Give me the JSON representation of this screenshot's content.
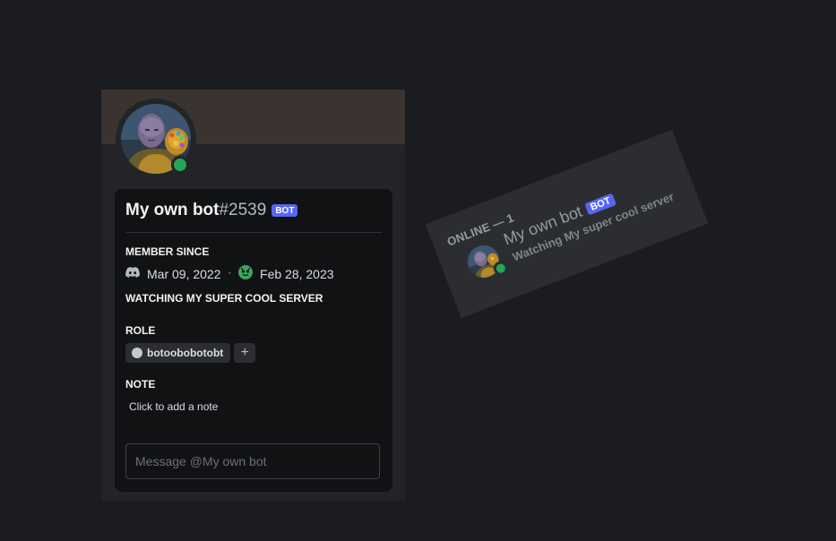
{
  "profile": {
    "username": "My own bot",
    "discriminator": "#2539",
    "bot_tag": "BOT",
    "member_since": {
      "title": "MEMBER SINCE",
      "discord_date": "Mar 09, 2022",
      "separator": "•",
      "server_date": "Feb 28, 2023"
    },
    "activity": "WATCHING MY SUPER COOL SERVER",
    "roles": {
      "title": "ROLE",
      "items": [
        {
          "label": "botoobobotobt",
          "color": "#c4c9ce"
        }
      ],
      "add_icon": "plus-icon",
      "add_label": "+"
    },
    "note": {
      "title": "NOTE",
      "placeholder": "Click to add a note"
    },
    "message": {
      "placeholder": "Message @My own bot"
    },
    "status": "online",
    "status_color": "#23a55a",
    "banner_color": "#3a3330"
  },
  "member_list": {
    "header": "ONLINE — 1",
    "members": [
      {
        "name": "My own bot",
        "bot_tag": "BOT",
        "activity": "Watching My super cool server",
        "status": "online"
      }
    ]
  },
  "colors": {
    "accent": "#5865f2",
    "online": "#23a55a",
    "background": "#1b1c22"
  }
}
